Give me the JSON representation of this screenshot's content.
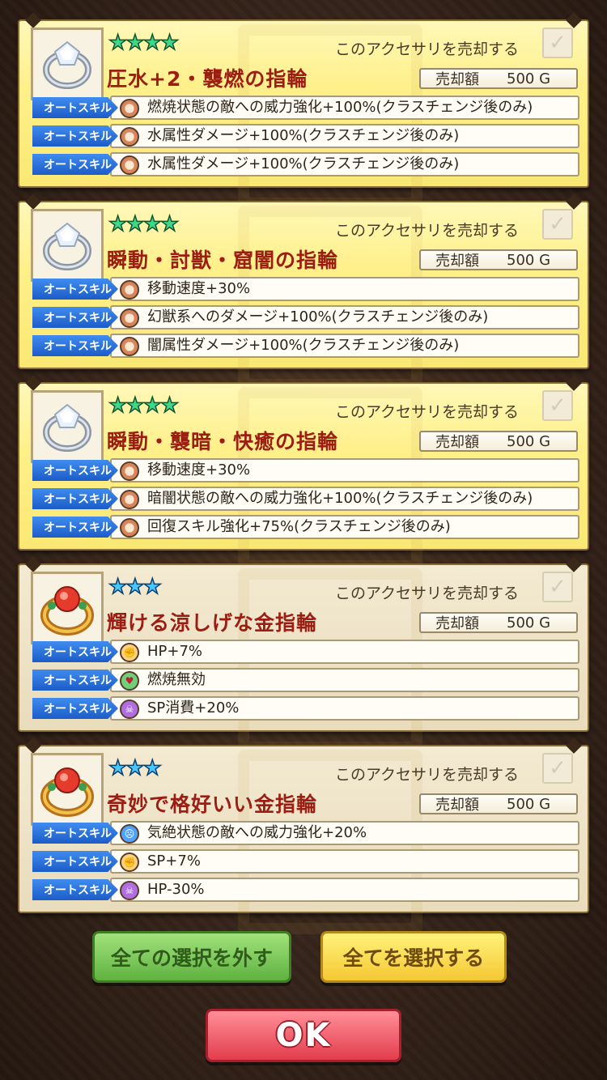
{
  "sell_label": "このアクセサリを売却する",
  "price_label": "売却額",
  "auto_skill_label": "オートスキル",
  "accessories": [
    {
      "stars": "★★★★",
      "name": "圧水+2・襲燃の指輪",
      "price": "500 G",
      "skills": [
        {
          "icon": "pot-icon",
          "text": "燃焼状態の敵への威力強化+100%(クラスチェンジ後のみ)"
        },
        {
          "icon": "pot-icon",
          "text": "水属性ダメージ+100%(クラスチェンジ後のみ)"
        },
        {
          "icon": "pot-icon",
          "text": "水属性ダメージ+100%(クラスチェンジ後のみ)"
        }
      ]
    },
    {
      "stars": "★★★★",
      "name": "瞬動・討獣・窟闇の指輪",
      "price": "500 G",
      "skills": [
        {
          "icon": "pot-icon",
          "text": "移動速度+30%"
        },
        {
          "icon": "pot-icon",
          "text": "幻獣系へのダメージ+100%(クラスチェンジ後のみ)"
        },
        {
          "icon": "pot-icon",
          "text": "闇属性ダメージ+100%(クラスチェンジ後のみ)"
        }
      ]
    },
    {
      "stars": "★★★★",
      "name": "瞬動・襲暗・快癒の指輪",
      "price": "500 G",
      "skills": [
        {
          "icon": "pot-icon",
          "text": "移動速度+30%"
        },
        {
          "icon": "pot-icon",
          "text": "暗闇状態の敵への威力強化+100%(クラスチェンジ後のみ)"
        },
        {
          "icon": "pot-icon",
          "text": "回復スキル強化+75%(クラスチェンジ後のみ)"
        }
      ]
    },
    {
      "stars": "★★★",
      "name": "輝ける涼しげな金指輪",
      "price": "500 G",
      "skills": [
        {
          "icon": "hp-icon",
          "text": "HP+7%"
        },
        {
          "icon": "fire-icon",
          "text": "燃焼無効"
        },
        {
          "icon": "skull-icon",
          "text": "SP消費+20%"
        }
      ]
    },
    {
      "stars": "★★★",
      "name": "奇妙で格好いい金指輪",
      "price": "500 G",
      "skills": [
        {
          "icon": "stun-icon",
          "text": "気絶状態の敵への威力強化+20%"
        },
        {
          "icon": "hp-icon",
          "text": "SP+7%"
        },
        {
          "icon": "skull-icon",
          "text": "HP-30%"
        }
      ]
    }
  ],
  "buttons": {
    "deselect_all": "全ての選択を外す",
    "select_all": "全てを選択する",
    "ok": "OK"
  },
  "colors": {
    "gold_card": "#fff08a",
    "beige_card": "#e9dcbb",
    "name_red": "#9c1d12",
    "auto_tag_blue": "#2a6fe0",
    "ok_red": "#e33d4d"
  }
}
